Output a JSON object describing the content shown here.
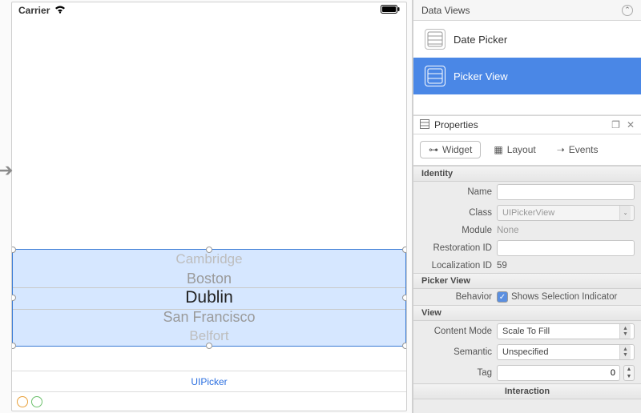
{
  "statusbar": {
    "carrier": "Carrier"
  },
  "picker": {
    "items": [
      "Cambridge",
      "Boston",
      "Dublin",
      "San Francisco",
      "Belfort"
    ],
    "selected_index": 2,
    "footer_label": "UIPicker"
  },
  "data_views": {
    "title": "Data Views",
    "items": [
      {
        "label": "Date Picker"
      },
      {
        "label": "Picker View"
      }
    ],
    "selected_index": 1
  },
  "properties": {
    "title": "Properties",
    "tabs": {
      "widget": "Widget",
      "layout": "Layout",
      "events": "Events"
    },
    "sections": {
      "identity": {
        "title": "Identity",
        "name": {
          "label": "Name",
          "value": ""
        },
        "class": {
          "label": "Class",
          "value": "UIPickerView"
        },
        "module": {
          "label": "Module",
          "value": "None"
        },
        "restoration_id": {
          "label": "Restoration ID",
          "value": ""
        },
        "localization_id": {
          "label": "Localization ID",
          "value": "59"
        }
      },
      "picker_view": {
        "title": "Picker View",
        "behavior": {
          "label": "Behavior",
          "checkbox_label": "Shows Selection Indicator",
          "checked": true
        }
      },
      "view": {
        "title": "View",
        "content_mode": {
          "label": "Content Mode",
          "value": "Scale To Fill"
        },
        "semantic": {
          "label": "Semantic",
          "value": "Unspecified"
        },
        "tag": {
          "label": "Tag",
          "value": "0"
        }
      },
      "interaction": {
        "title": "Interaction"
      }
    }
  }
}
